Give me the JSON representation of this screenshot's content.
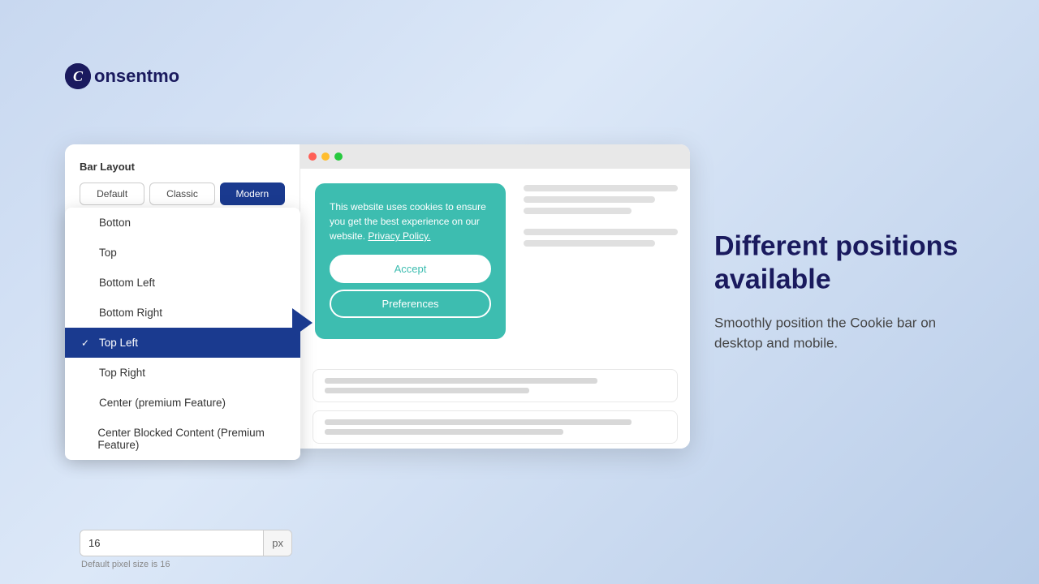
{
  "logo": {
    "icon_char": "C",
    "text": "onsentmo"
  },
  "panel": {
    "settings": {
      "bar_layout_label": "Bar Layout",
      "buttons": [
        {
          "label": "Default",
          "active": false
        },
        {
          "label": "Classic",
          "active": false
        },
        {
          "label": "Modern",
          "active": true
        }
      ],
      "pixel_input_value": "16",
      "pixel_unit": "px",
      "pixel_hint": "Default pixel size is 16"
    },
    "dropdown": {
      "items": [
        {
          "label": "Botton",
          "selected": false,
          "has_check": false
        },
        {
          "label": "Top",
          "selected": false,
          "has_check": false
        },
        {
          "label": "Bottom Left",
          "selected": false,
          "has_check": false
        },
        {
          "label": "Bottom Right",
          "selected": false,
          "has_check": false
        },
        {
          "label": "Top Left",
          "selected": true,
          "has_check": true
        },
        {
          "label": "Top Right",
          "selected": false,
          "has_check": false
        },
        {
          "label": "Center (premium Feature)",
          "selected": false,
          "has_check": false
        },
        {
          "label": "Center Blocked Content (Premium Feature)",
          "selected": false,
          "has_check": false
        }
      ]
    },
    "preview": {
      "cookie_text": "This website uses cookies to ensure you get the best experience on our website.",
      "cookie_link": "Privacy Policy.",
      "accept_btn": "Accept",
      "preferences_btn": "Preferences"
    }
  },
  "right": {
    "heading": "Different positions available",
    "description": "Smoothly position the Cookie bar on desktop and mobile."
  }
}
